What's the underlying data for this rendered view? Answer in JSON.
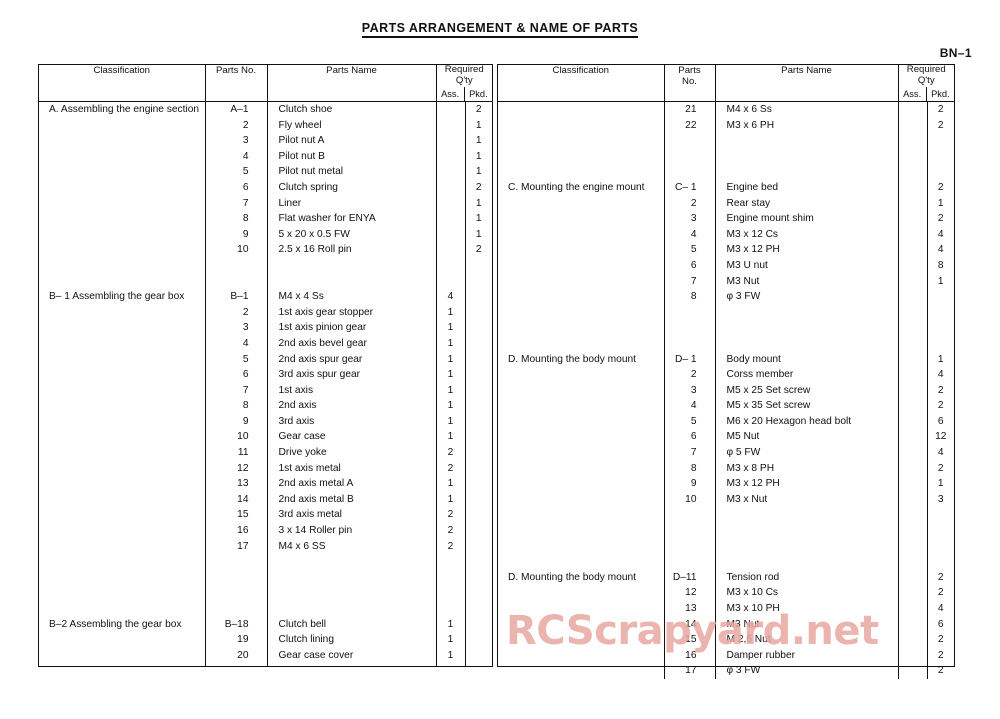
{
  "document": {
    "title": "PARTS ARRANGEMENT & NAME OF PARTS",
    "page_number": "BN–1",
    "watermark": "RCScrapyard.net",
    "watermark_color": "#e8a8a2"
  },
  "columns": {
    "classification": "Classification",
    "parts_no_left": "Parts No.",
    "parts_no_right_line1": "Parts",
    "parts_no_right_line2": "No.",
    "parts_name": "Parts Name",
    "required_line1": "Required",
    "required_line2": "Q'ty",
    "ass": "Ass.",
    "pkd": "Pkd."
  },
  "left_table": {
    "rows": [
      {
        "classification": "A.  Assembling the engine section",
        "no": "A–1",
        "name": "Clutch shoe",
        "ass": "",
        "pkd": "2"
      },
      {
        "classification": "",
        "no": "2",
        "name": "Fly wheel",
        "ass": "",
        "pkd": "1"
      },
      {
        "classification": "",
        "no": "3",
        "name": "Pilot nut A",
        "ass": "",
        "pkd": "1"
      },
      {
        "classification": "",
        "no": "4",
        "name": "Pilot nut B",
        "ass": "",
        "pkd": "1"
      },
      {
        "classification": "",
        "no": "5",
        "name": "Pilot nut metal",
        "ass": "",
        "pkd": "1"
      },
      {
        "classification": "",
        "no": "6",
        "name": "Clutch spring",
        "ass": "",
        "pkd": "2"
      },
      {
        "classification": "",
        "no": "7",
        "name": "Liner",
        "ass": "",
        "pkd": "1"
      },
      {
        "classification": "",
        "no": "8",
        "name": "Flat washer for ENYA",
        "ass": "",
        "pkd": "1"
      },
      {
        "classification": "",
        "no": "9",
        "name": "5 x 20 x 0.5 FW",
        "ass": "",
        "pkd": "1"
      },
      {
        "classification": "",
        "no": "10",
        "name": "2.5 x 16  Roll pin",
        "ass": "",
        "pkd": "2"
      },
      {
        "spacer": true
      },
      {
        "spacer": true
      },
      {
        "classification": "B– 1  Assembling the gear box",
        "no": "B–1",
        "name": "M4 x 4 Ss",
        "ass": "4",
        "pkd": ""
      },
      {
        "classification": "",
        "no": "2",
        "name": "1st axis gear stopper",
        "ass": "1",
        "pkd": ""
      },
      {
        "classification": "",
        "no": "3",
        "name": "1st axis pinion gear",
        "ass": "1",
        "pkd": ""
      },
      {
        "classification": "",
        "no": "4",
        "name": "2nd axis bevel gear",
        "ass": "1",
        "pkd": ""
      },
      {
        "classification": "",
        "no": "5",
        "name": "2nd axis spur gear",
        "ass": "1",
        "pkd": ""
      },
      {
        "classification": "",
        "no": "6",
        "name": "3rd axis spur gear",
        "ass": "1",
        "pkd": ""
      },
      {
        "classification": "",
        "no": "7",
        "name": "1st axis",
        "ass": "1",
        "pkd": ""
      },
      {
        "classification": "",
        "no": "8",
        "name": "2nd axis",
        "ass": "1",
        "pkd": ""
      },
      {
        "classification": "",
        "no": "9",
        "name": "3rd axis",
        "ass": "1",
        "pkd": ""
      },
      {
        "classification": "",
        "no": "10",
        "name": "Gear case",
        "ass": "1",
        "pkd": ""
      },
      {
        "classification": "",
        "no": "11",
        "name": "Drive yoke",
        "ass": "2",
        "pkd": ""
      },
      {
        "classification": "",
        "no": "12",
        "name": "1st axis metal",
        "ass": "2",
        "pkd": ""
      },
      {
        "classification": "",
        "no": "13",
        "name": "2nd axis metal A",
        "ass": "1",
        "pkd": ""
      },
      {
        "classification": "",
        "no": "14",
        "name": "2nd axis metal B",
        "ass": "1",
        "pkd": ""
      },
      {
        "classification": "",
        "no": "15",
        "name": "3rd axis metal",
        "ass": "2",
        "pkd": ""
      },
      {
        "classification": "",
        "no": "16",
        "name": "3 x 14  Roller pin",
        "ass": "2",
        "pkd": ""
      },
      {
        "classification": "",
        "no": "17",
        "name": "M4 x 6 SS",
        "ass": "2",
        "pkd": ""
      },
      {
        "spacer": true
      },
      {
        "spacer": true
      },
      {
        "spacer": true
      },
      {
        "spacer": true
      },
      {
        "classification": "B–2  Assembling the gear box",
        "no": "B–18",
        "name": "Clutch bell",
        "ass": "1",
        "pkd": ""
      },
      {
        "classification": "",
        "no": "19",
        "name": "Clutch lining",
        "ass": "1",
        "pkd": ""
      },
      {
        "classification": "",
        "no": "20",
        "name": "Gear case cover",
        "ass": "1",
        "pkd": ""
      }
    ]
  },
  "right_table": {
    "rows": [
      {
        "classification": "",
        "no": "21",
        "name": "M4 x 6 Ss",
        "ass": "",
        "pkd": "2"
      },
      {
        "classification": "",
        "no": "22",
        "name": "M3 x 6 PH",
        "ass": "",
        "pkd": "2"
      },
      {
        "spacer": true
      },
      {
        "spacer": true
      },
      {
        "spacer": true
      },
      {
        "classification": "C.  Mounting the engine mount",
        "no": "C– 1",
        "name": "Engine  bed",
        "ass": "",
        "pkd": "2"
      },
      {
        "classification": "",
        "no": "2",
        "name": "Rear stay",
        "ass": "",
        "pkd": "1"
      },
      {
        "classification": "",
        "no": "3",
        "name": "Engine mount shim",
        "ass": "",
        "pkd": "2"
      },
      {
        "classification": "",
        "no": "4",
        "name": "M3 x 12 Cs",
        "ass": "",
        "pkd": "4"
      },
      {
        "classification": "",
        "no": "5",
        "name": "M3 x 12 PH",
        "ass": "",
        "pkd": "4"
      },
      {
        "classification": "",
        "no": "6",
        "name": "M3 U nut",
        "ass": "",
        "pkd": "8"
      },
      {
        "classification": "",
        "no": "7",
        "name": "M3 Nut",
        "ass": "",
        "pkd": "1"
      },
      {
        "classification": "",
        "no": "8",
        "name": "φ 3 FW",
        "ass": "",
        "pkd": ""
      },
      {
        "spacer": true
      },
      {
        "spacer": true
      },
      {
        "spacer": true
      },
      {
        "classification": "D.  Mounting the body mount",
        "no": "D– 1",
        "name": "Body mount",
        "ass": "",
        "pkd": "1"
      },
      {
        "classification": "",
        "no": "2",
        "name": "Corss member",
        "ass": "",
        "pkd": "4"
      },
      {
        "classification": "",
        "no": "3",
        "name": "M5 x 25 Set screw",
        "ass": "",
        "pkd": "2"
      },
      {
        "classification": "",
        "no": "4",
        "name": "M5 x 35  Set screw",
        "ass": "",
        "pkd": "2"
      },
      {
        "classification": "",
        "no": "5",
        "name": "M6 x 20 Hexagon head bolt",
        "ass": "",
        "pkd": "6"
      },
      {
        "classification": "",
        "no": "6",
        "name": "M5 Nut",
        "ass": "",
        "pkd": "12"
      },
      {
        "classification": "",
        "no": "7",
        "name": "φ 5 FW",
        "ass": "",
        "pkd": "4"
      },
      {
        "classification": "",
        "no": "8",
        "name": "M3 x 8 PH",
        "ass": "",
        "pkd": "2"
      },
      {
        "classification": "",
        "no": "9",
        "name": "M3 x 12 PH",
        "ass": "",
        "pkd": "1"
      },
      {
        "classification": "",
        "no": "10",
        "name": "M3 x Nut",
        "ass": "",
        "pkd": "3"
      },
      {
        "spacer": true
      },
      {
        "spacer": true
      },
      {
        "spacer": true
      },
      {
        "spacer": true
      },
      {
        "classification": "D. Mounting the body mount",
        "no": "D–11",
        "name": "Tension rod",
        "ass": "",
        "pkd": "2"
      },
      {
        "classification": "",
        "no": "12",
        "name": "M3 x 10 Cs",
        "ass": "",
        "pkd": "2"
      },
      {
        "classification": "",
        "no": "13",
        "name": "M3 x 10 PH",
        "ass": "",
        "pkd": "4"
      },
      {
        "classification": "",
        "no": "14",
        "name": "M3 Nut",
        "ass": "",
        "pkd": "6"
      },
      {
        "classification": "",
        "no": "15",
        "name": "M 2,6 Nut",
        "ass": "",
        "pkd": "2"
      },
      {
        "classification": "",
        "no": "16",
        "name": "Damper rubber",
        "ass": "",
        "pkd": "2"
      },
      {
        "classification": "",
        "no": "17",
        "name": "φ 3 FW",
        "ass": "",
        "pkd": "2"
      }
    ]
  }
}
